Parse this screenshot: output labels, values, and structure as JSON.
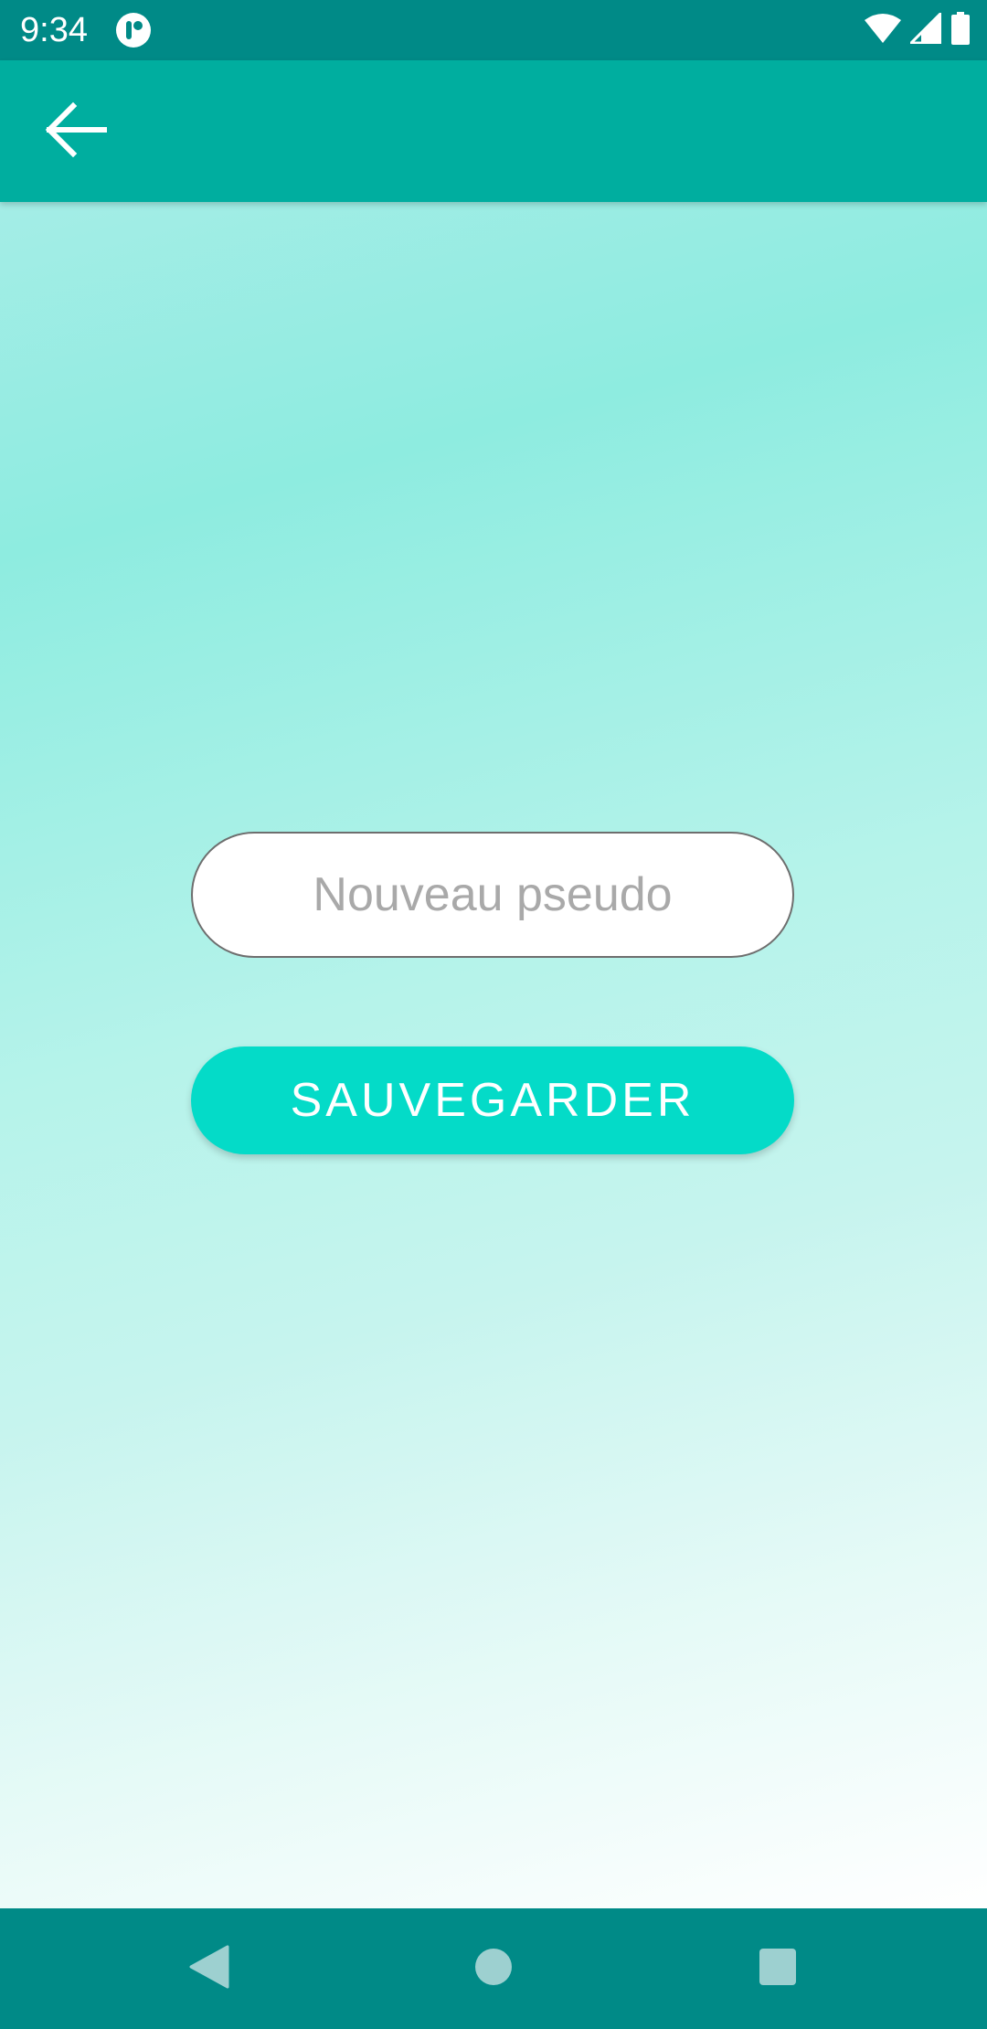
{
  "status_bar": {
    "time": "9:34",
    "icons": [
      "app-notification-icon",
      "wifi-icon",
      "cell-signal-icon",
      "battery-icon"
    ]
  },
  "app_bar": {
    "back_icon": "arrow-back-icon"
  },
  "form": {
    "pseudo_placeholder": "Nouveau pseudo",
    "pseudo_value": "",
    "save_label": "SAUVEGARDER"
  },
  "nav_bar": {
    "buttons": [
      "back-triangle-icon",
      "home-circle-icon",
      "recents-square-icon"
    ]
  },
  "colors": {
    "status_bar": "#008a87",
    "app_bar": "#00ae9f",
    "save_button": "#04dbc8",
    "nav_bar": "#008a87"
  }
}
